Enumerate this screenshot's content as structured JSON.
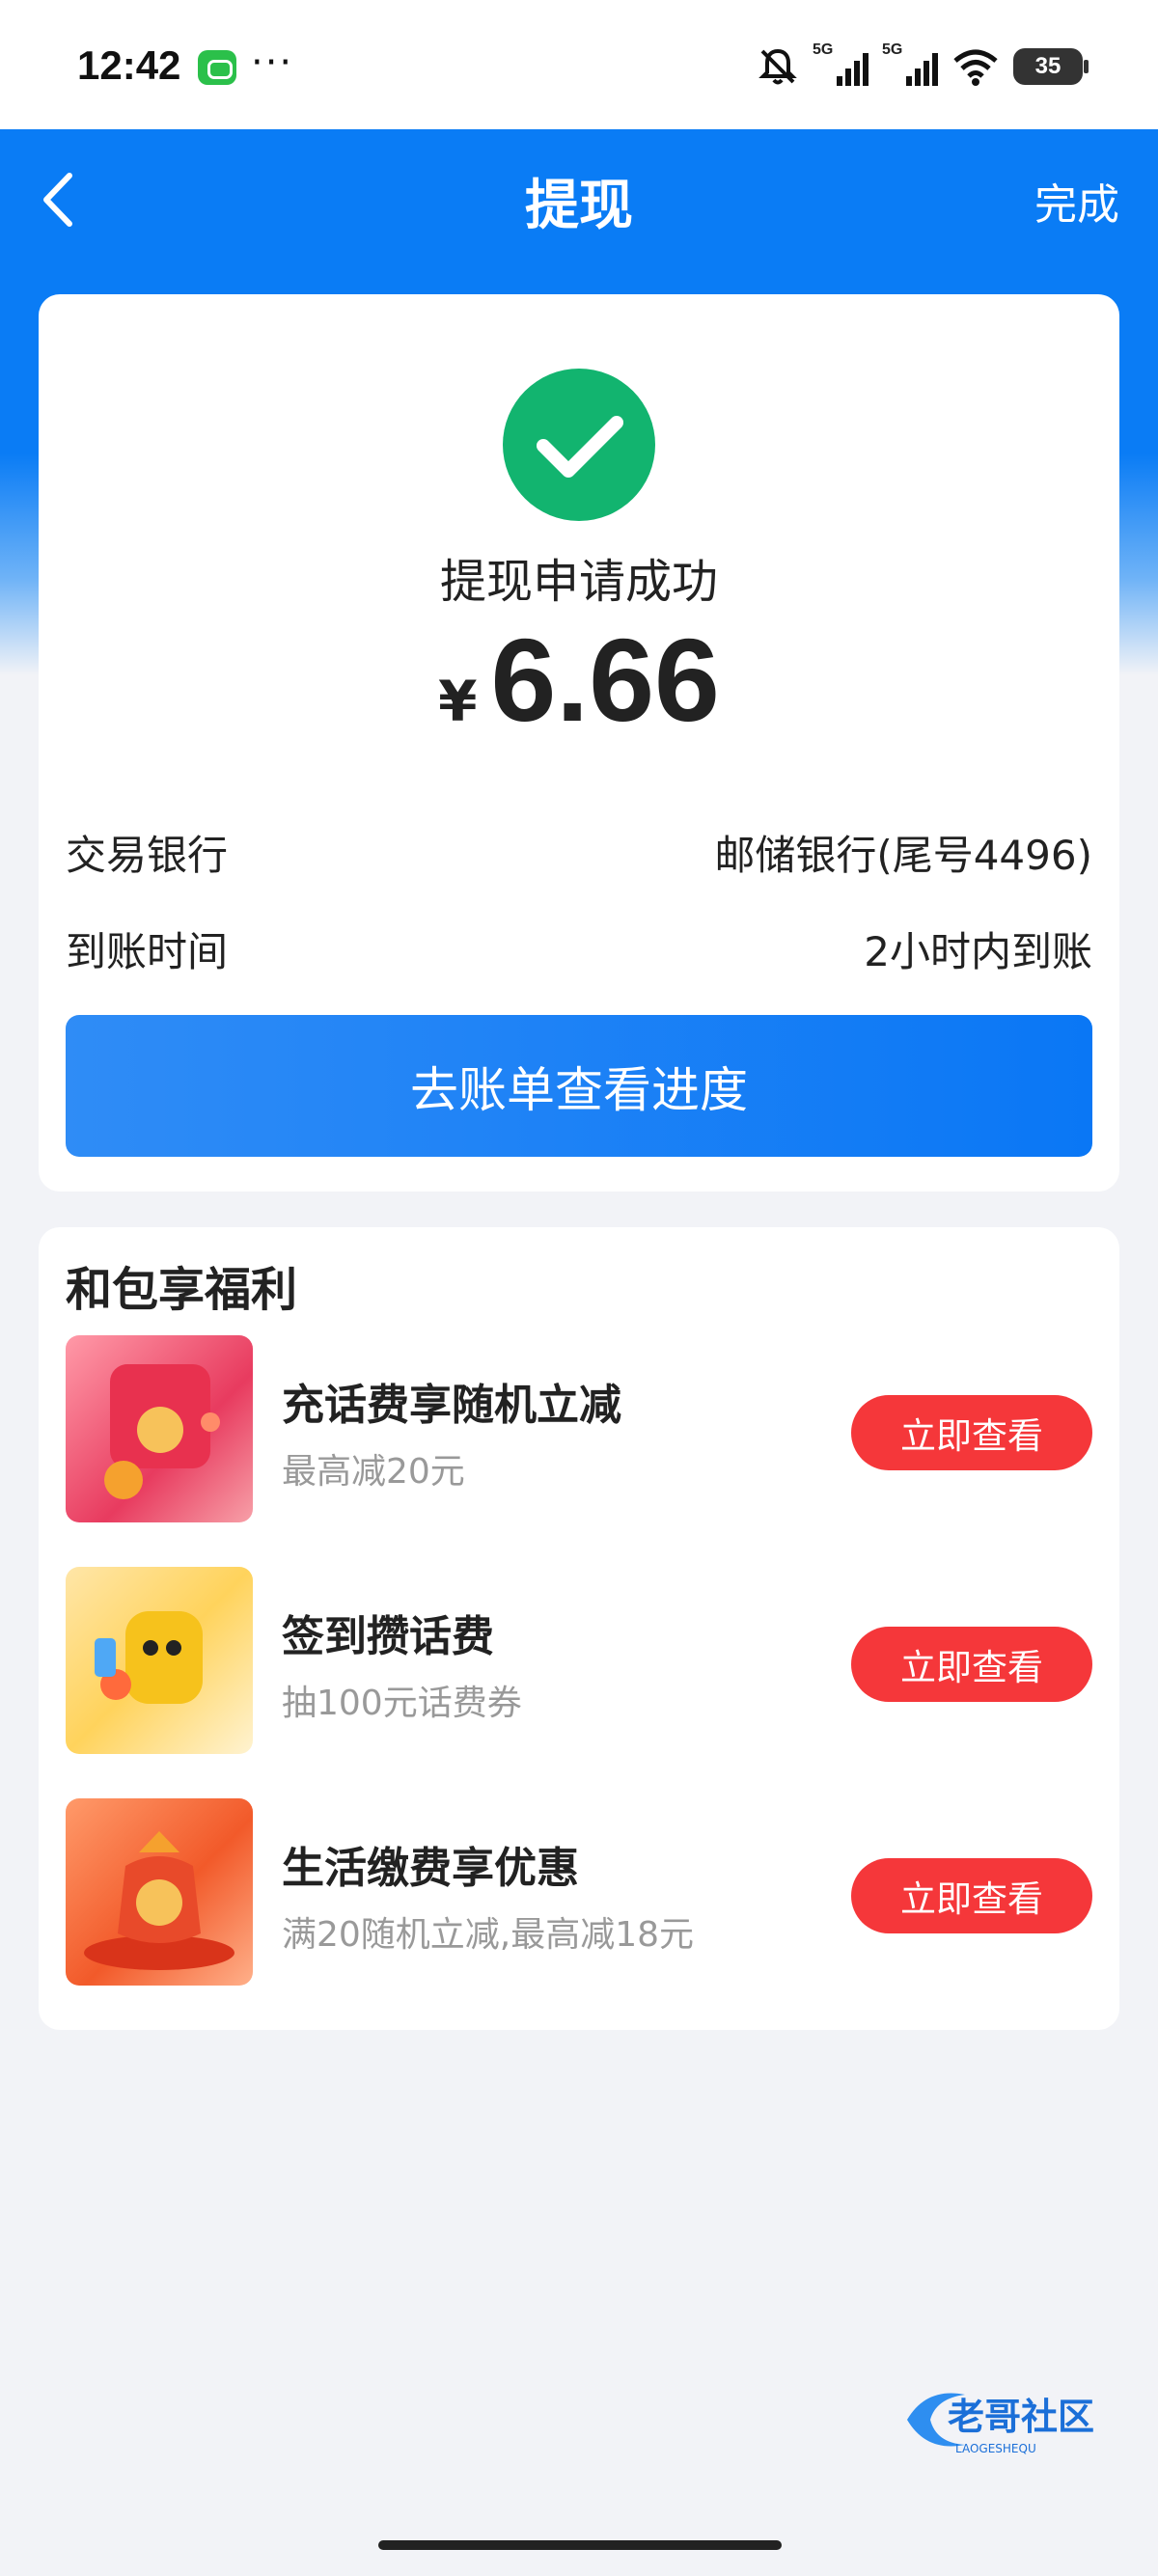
{
  "status_bar": {
    "time": "12:42",
    "dots": "···",
    "signal1_tag": "5G",
    "signal2_tag": "5G",
    "battery": "35"
  },
  "nav": {
    "back_icon": "chevron-left-icon",
    "title": "提现",
    "done_label": "完成"
  },
  "result": {
    "icon": "check-circle-icon",
    "title": "提现申请成功",
    "currency": "¥",
    "amount": "6.66",
    "rows": [
      {
        "label": "交易银行",
        "value": "邮储银行(尾号4496)"
      },
      {
        "label": "到账时间",
        "value": "2小时内到账"
      }
    ],
    "cta_label": "去账单查看进度"
  },
  "benefits": {
    "title": "和包享福利",
    "items": [
      {
        "name": "充话费享随机立减",
        "desc": "最高减20元",
        "button": "立即查看"
      },
      {
        "name": "签到攒话费",
        "desc": "抽100元话费券",
        "button": "立即查看"
      },
      {
        "name": "生活缴费享优惠",
        "desc": "满20随机立减,最高减18元",
        "button": "立即查看"
      }
    ]
  },
  "watermark": {
    "text": "老哥社区",
    "subtext": "LAOGESHEQU"
  },
  "colors": {
    "primary_blue": "#0a7cf5",
    "success_green": "#12b46f",
    "cta_red": "#f5373a",
    "page_bg": "#f2f3f7"
  }
}
